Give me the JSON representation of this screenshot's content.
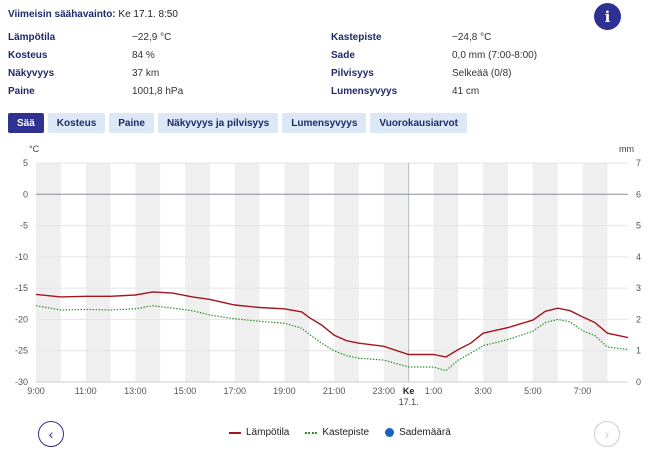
{
  "latest": {
    "label": "Viimeisin säähavainto:",
    "time": "Ke 17.1. 8:50"
  },
  "info_icon": "info-icon",
  "observations": {
    "left": [
      {
        "label": "Lämpötila",
        "value": "−22,9 °C"
      },
      {
        "label": "Kosteus",
        "value": "84 %"
      },
      {
        "label": "Näkyvyys",
        "value": "37 km"
      },
      {
        "label": "Paine",
        "value": "1001,8 hPa"
      }
    ],
    "right": [
      {
        "label": "Kastepiste",
        "value": "−24,8 °C"
      },
      {
        "label": "Sade",
        "value": "0,0 mm (7:00-8:00)"
      },
      {
        "label": "Pilvisyys",
        "value": "Selkeää (0/8)"
      },
      {
        "label": "Lumensyvyys",
        "value": "41 cm"
      }
    ]
  },
  "tabs": [
    {
      "label": "Sää",
      "active": true
    },
    {
      "label": "Kosteus",
      "active": false
    },
    {
      "label": "Paine",
      "active": false
    },
    {
      "label": "Näkyvyys ja pilvisyys",
      "active": false
    },
    {
      "label": "Lumensyvyys",
      "active": false
    },
    {
      "label": "Vuorokausiarvot",
      "active": false
    }
  ],
  "nav": {
    "prev_icon": "chevron-left-icon",
    "next_icon": "chevron-right-icon"
  },
  "colors": {
    "temperature": "#a3161d",
    "dewpoint": "#2f8f2f",
    "precip": "#1565c0",
    "accent": "#2e3192"
  },
  "chart_data": {
    "type": "line",
    "y_left": {
      "unit": "°C",
      "ylim": [
        -30,
        5
      ],
      "ticks": [
        5,
        0,
        -5,
        -10,
        -15,
        -20,
        -25,
        -30
      ]
    },
    "y_right": {
      "unit": "mm",
      "ylim": [
        0,
        7
      ],
      "ticks": [
        7,
        6,
        5,
        4,
        3,
        2,
        1,
        0
      ]
    },
    "x": {
      "start_hour": 9,
      "end_hour": 32.83,
      "day_marker_hour": 24,
      "tick_labels": [
        "9:00",
        "11:00",
        "13:00",
        "15:00",
        "17:00",
        "19:00",
        "21:00",
        "23:00",
        "1:00",
        "3:00",
        "5:00",
        "7:00"
      ],
      "tick_hours": [
        9,
        11,
        13,
        15,
        17,
        19,
        21,
        23,
        25,
        27,
        29,
        31
      ],
      "day_label": [
        "Ke",
        "17.1."
      ]
    },
    "series": [
      {
        "name": "Lämpötila",
        "values": [
          [
            9,
            -16.0
          ],
          [
            10,
            -16.4
          ],
          [
            11,
            -16.3
          ],
          [
            12,
            -16.3
          ],
          [
            13,
            -16.1
          ],
          [
            13.7,
            -15.6
          ],
          [
            14.5,
            -15.8
          ],
          [
            15.3,
            -16.4
          ],
          [
            16,
            -16.8
          ],
          [
            17,
            -17.7
          ],
          [
            18,
            -18.1
          ],
          [
            19,
            -18.3
          ],
          [
            19.7,
            -18.8
          ],
          [
            20,
            -19.7
          ],
          [
            20.5,
            -20.9
          ],
          [
            21,
            -22.5
          ],
          [
            21.5,
            -23.4
          ],
          [
            22,
            -23.8
          ],
          [
            23,
            -24.3
          ],
          [
            24,
            -25.6
          ],
          [
            25,
            -25.6
          ],
          [
            25.5,
            -26.0
          ],
          [
            26,
            -24.8
          ],
          [
            26.5,
            -23.8
          ],
          [
            27,
            -22.2
          ],
          [
            28,
            -21.3
          ],
          [
            29,
            -20.1
          ],
          [
            29.5,
            -18.7
          ],
          [
            30,
            -18.2
          ],
          [
            30.5,
            -18.6
          ],
          [
            31,
            -19.6
          ],
          [
            31.5,
            -20.5
          ],
          [
            32,
            -22.2
          ],
          [
            32.83,
            -22.9
          ]
        ]
      },
      {
        "name": "Kastepiste",
        "values": [
          [
            9,
            -17.8
          ],
          [
            10,
            -18.5
          ],
          [
            11,
            -18.4
          ],
          [
            12,
            -18.5
          ],
          [
            13,
            -18.3
          ],
          [
            13.7,
            -17.8
          ],
          [
            14.5,
            -18.2
          ],
          [
            15.3,
            -18.6
          ],
          [
            16,
            -19.3
          ],
          [
            17,
            -19.9
          ],
          [
            18,
            -20.3
          ],
          [
            19,
            -20.6
          ],
          [
            19.7,
            -21.4
          ],
          [
            20,
            -22.4
          ],
          [
            20.5,
            -23.8
          ],
          [
            21,
            -25.0
          ],
          [
            21.5,
            -25.8
          ],
          [
            22,
            -26.2
          ],
          [
            23,
            -26.5
          ],
          [
            24,
            -27.6
          ],
          [
            25,
            -27.6
          ],
          [
            25.5,
            -28.2
          ],
          [
            26,
            -26.5
          ],
          [
            26.5,
            -25.4
          ],
          [
            27,
            -24.2
          ],
          [
            28,
            -23.2
          ],
          [
            29,
            -21.9
          ],
          [
            29.5,
            -20.5
          ],
          [
            30,
            -20.0
          ],
          [
            30.5,
            -20.4
          ],
          [
            31,
            -21.8
          ],
          [
            31.5,
            -22.6
          ],
          [
            32,
            -24.4
          ],
          [
            32.83,
            -24.8
          ]
        ]
      }
    ],
    "precipitation": {
      "name": "Sademäärä",
      "values": []
    },
    "grid": true,
    "legend": "bottom-center"
  }
}
